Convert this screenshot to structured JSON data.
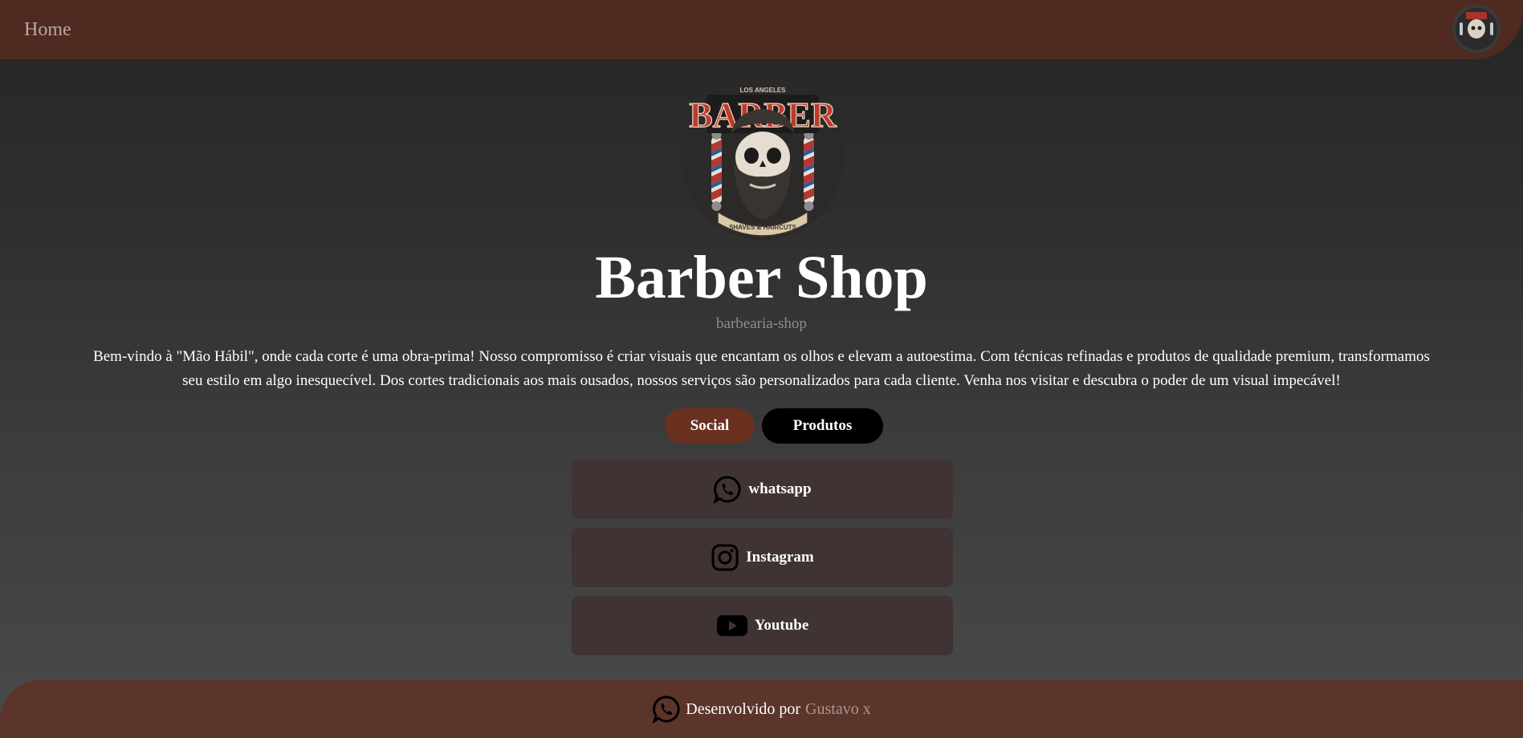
{
  "nav": {
    "home_label": "Home",
    "avatar_icon": "barber-logo-icon"
  },
  "hero": {
    "title": "Barber Shop",
    "handle": "barbearia-shop",
    "description": "Bem-vindo à \"Mão Hábil\", onde cada corte é uma obra-prima! Nosso compromisso é criar visuais que encantam os olhos e elevam a autoestima. Com técnicas refinadas e produtos de qualidade premium, transformamos seu estilo em algo inesquecível. Dos cortes tradicionais aos mais ousados, nossos serviços são personalizados para cada cliente. Venha nos visitar e descubra o poder de um visual impecável!",
    "logo": {
      "top_text": "LOS ANGELES",
      "main_text": "BARBER",
      "bottom_text": "SHAVES & HAIRCUTS"
    }
  },
  "tabs": [
    {
      "label": "Social",
      "active": true
    },
    {
      "label": "Produtos",
      "active": false
    }
  ],
  "links": [
    {
      "label": "whatsapp",
      "icon": "whatsapp-icon"
    },
    {
      "label": "Instagram",
      "icon": "instagram-icon"
    },
    {
      "label": "Youtube",
      "icon": "youtube-icon"
    }
  ],
  "footer": {
    "prefix": "Desenvolvido por",
    "author": "Gustavo x",
    "icon": "whatsapp-icon"
  },
  "colors": {
    "nav_bg": "#4f2a20",
    "footer_bg": "#5b342a",
    "tab_active": "#6a3020",
    "tab_inactive": "#000000",
    "card_bg": "#3f3333"
  }
}
